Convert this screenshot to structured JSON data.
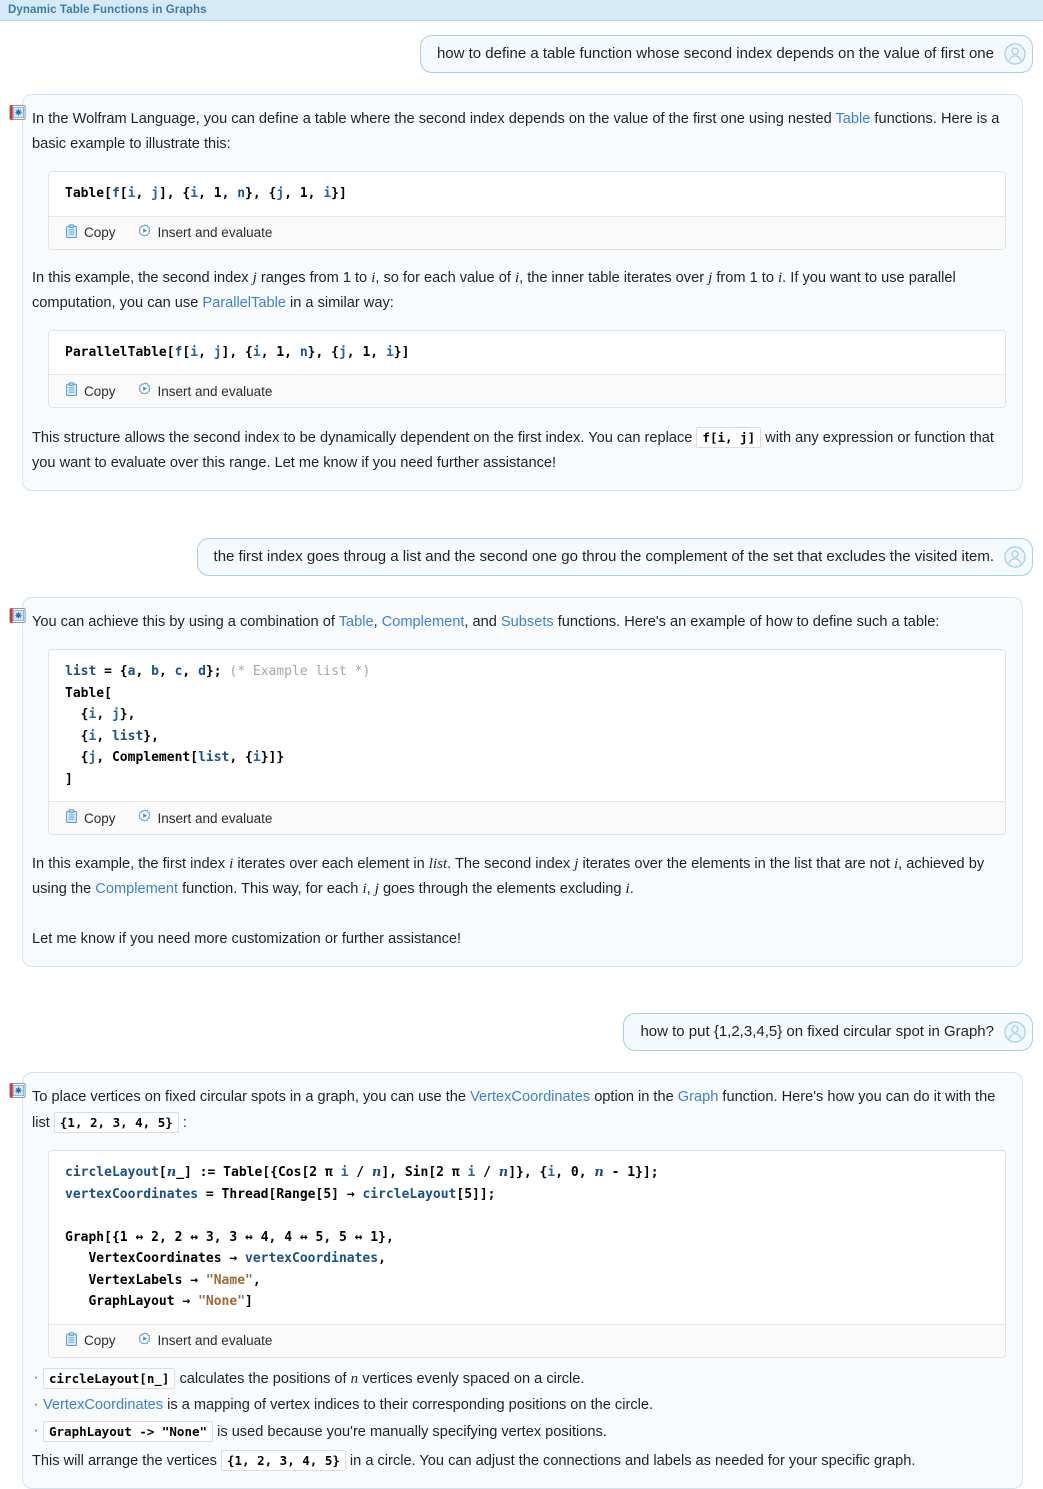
{
  "window": {
    "title": "Dynamic Table Functions in Graphs"
  },
  "icons": {
    "user_avatar": "user-avatar-icon",
    "assistant": "wolfram-notebook-icon",
    "copy": "clipboard-icon",
    "evaluate": "insert-and-evaluate-icon"
  },
  "colors": {
    "title_text": "#3a7ca8",
    "title_bar_bg": "#d6eaf5",
    "user_bubble_bg": "#f4fafe",
    "user_bubble_border": "#a8cfe8",
    "assistant_card_bg": "#f7fbfe",
    "assistant_card_border": "#cfe4f2",
    "link": "#3e7fd4",
    "code_symbol": "#1b4f8a",
    "code_string": "#9b6a3a",
    "code_comment": "#a0a6aa"
  },
  "code_toolbar": {
    "copy_label": "Copy",
    "evaluate_label": "Insert and evaluate"
  },
  "messages": [
    {
      "role": "user",
      "text": "how to define a table function whose second index depends on the value of first one"
    },
    {
      "role": "assistant",
      "paragraph_1_a": "In the Wolfram Language, you can define a table where the second index depends on the value of the first one using nested ",
      "paragraph_1_link": "Table",
      "paragraph_1_b": " functions. Here is a basic example to illustrate this:",
      "code_1": "Table[f[i, j], {i, 1, n}, {j, 1, i}]",
      "paragraph_2_a": "In this example, the second index ",
      "paragraph_2_m1": "j",
      "paragraph_2_b": " ranges from 1 to ",
      "paragraph_2_m2": "i",
      "paragraph_2_c": ", so for each value of ",
      "paragraph_2_m3": "i",
      "paragraph_2_d": ", the inner table iterates over ",
      "paragraph_2_m4": "j",
      "paragraph_2_e": " from 1 to ",
      "paragraph_2_m5": "i",
      "paragraph_2_f": ". If you want to use parallel computation, you can use ",
      "paragraph_2_link": "ParallelTable",
      "paragraph_2_g": " in a similar way:",
      "code_2": "ParallelTable[f[i, j], {i, 1, n}, {j, 1, i}]",
      "paragraph_3_a": "This structure allows the second index to be dynamically dependent on the first index. You can replace ",
      "paragraph_3_code": "f[i, j]",
      "paragraph_3_b": " with any expression or function that you want to evaluate over this range. Let me know if you need further assistance!"
    },
    {
      "role": "user",
      "text": "the first index goes throug a list and the second one go throu the complement of the set that excludes the visited item."
    },
    {
      "role": "assistant",
      "paragraph_1_a": "You can achieve this by using a combination of ",
      "paragraph_1_l1": "Table",
      "paragraph_1_b": ", ",
      "paragraph_1_l2": "Complement",
      "paragraph_1_c": ", and ",
      "paragraph_1_l3": "Subsets",
      "paragraph_1_d": " functions. Here's an example of how to define such a table:",
      "code_1_lines": [
        "list = {a, b, c, d}; (* Example list *)",
        "Table[",
        "  {i, j},",
        "  {i, list},",
        "  {j, Complement[list, {i}]}",
        "]"
      ],
      "paragraph_2_a": "In this example, the first index ",
      "paragraph_2_m1": "i",
      "paragraph_2_b": " iterates over each element in ",
      "paragraph_2_m2": "list",
      "paragraph_2_c": ". The second index ",
      "paragraph_2_m3": "j",
      "paragraph_2_d": " iterates over the elements in the list that are not ",
      "paragraph_2_m4": "i",
      "paragraph_2_e": ", achieved by using the ",
      "paragraph_2_link": "Complement",
      "paragraph_2_f": " function. This way, for each ",
      "paragraph_2_m5": "i",
      "paragraph_2_g": ", ",
      "paragraph_2_m6": "j",
      "paragraph_2_h": " goes through the elements excluding ",
      "paragraph_2_m7": "i",
      "paragraph_2_i": ".",
      "paragraph_3": "Let me know if you need more customization or further assistance!"
    },
    {
      "role": "user",
      "text": "how to put {1,2,3,4,5} on fixed circular spot in Graph?"
    },
    {
      "role": "assistant",
      "paragraph_1_a": "To place vertices on fixed circular spots in a graph, you can use the ",
      "paragraph_1_l1": "VertexCoordinates",
      "paragraph_1_b": " option in the ",
      "paragraph_1_l2": "Graph",
      "paragraph_1_c": " function. Here's how you can do it with the list ",
      "paragraph_1_code": "{1, 2, 3, 4, 5}",
      "paragraph_1_d": " :",
      "code_1_lines": [
        "circleLayout[n_] := Table[{Cos[2 π i / n], Sin[2 π i / n]}, {i, 0, n - 1}];",
        "vertexCoordinates = Thread[Range[5] → circleLayout[5]];",
        "",
        "Graph[{1 ↔ 2, 2 ↔ 3, 3 ↔ 4, 4 ↔ 5, 5 ↔ 1},",
        "   VertexCoordinates → vertexCoordinates,",
        "   VertexLabels → \"Name\",",
        "   GraphLayout → \"None\"]"
      ],
      "bullets": [
        {
          "code": "circleLayout[n_]",
          "text_a": " calculates the positions of ",
          "math": "n",
          "text_b": " vertices evenly spaced on a circle."
        },
        {
          "link": "VertexCoordinates",
          "text_a": " is a mapping of vertex indices to their corresponding positions on the circle."
        },
        {
          "code": "GraphLayout -> \"None\"",
          "text_a": " is used because you're manually specifying vertex positions."
        }
      ],
      "closing_a": "This will arrange the vertices ",
      "closing_code": "{1, 2, 3, 4, 5}",
      "closing_b": " in a circle. You can adjust the connections and labels as needed for your specific graph."
    }
  ]
}
